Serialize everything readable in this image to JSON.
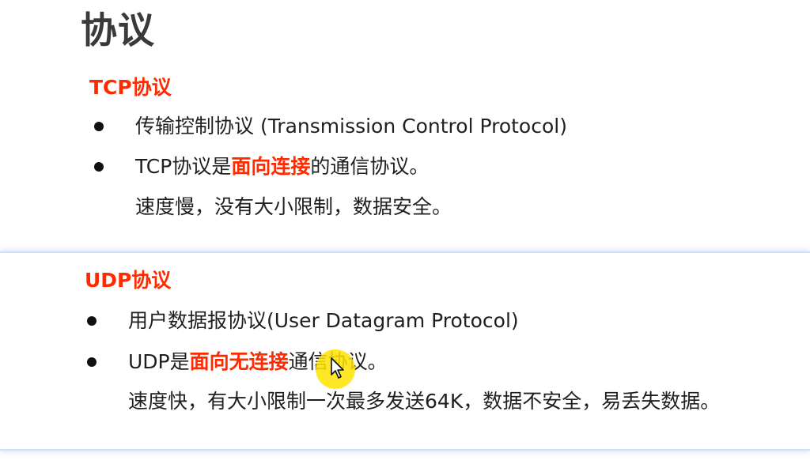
{
  "title": "协议",
  "tcp": {
    "heading": "TCP协议",
    "item1": "传输控制协议 (Transmission Control Protocol)",
    "item2_pre": "TCP协议是",
    "item2_highlight": "面向连接",
    "item2_post": "的通信协议。",
    "note": "速度慢，没有大小限制，数据安全。"
  },
  "udp": {
    "heading": "UDP协议",
    "item1": "用户数据报协议(User Datagram Protocol)",
    "item2_pre": "UDP是",
    "item2_highlight": "面向无连接",
    "item2_post": "通信协议。",
    "note": "速度快，有大小限制一次最多发送64K，数据不安全，易丢失数据。"
  },
  "colors": {
    "accent": "#ff2a00",
    "title": "#3a3a3a",
    "text": "#1f1f1f",
    "divider": "#cfe0f5",
    "cursor_highlight": "#ffe200"
  },
  "icons": {
    "bullet": "filled-circle",
    "cursor": "mouse-pointer-arrow"
  }
}
